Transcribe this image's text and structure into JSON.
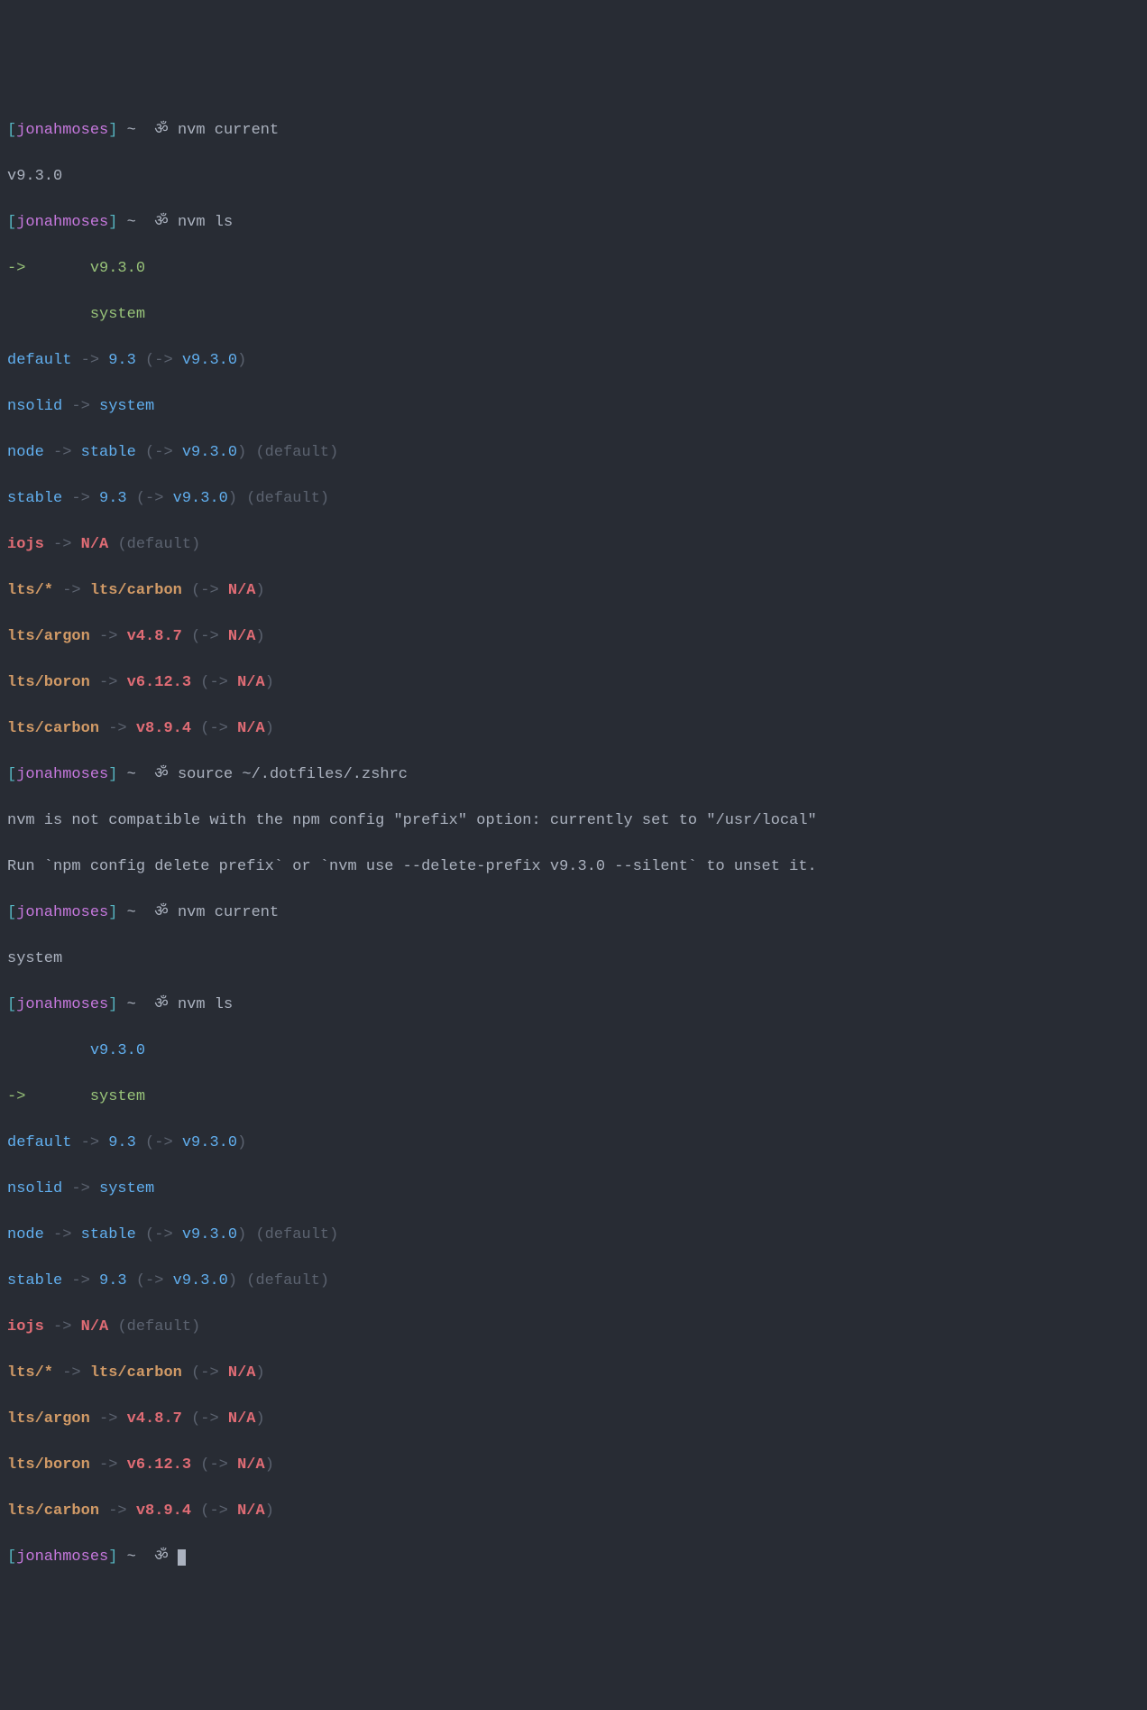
{
  "prompt": {
    "bracket_open": "[",
    "bracket_close": "]",
    "user": "jonahmoses",
    "tilde": "~",
    "om": "ॐ"
  },
  "cmd": {
    "nvm_current": "nvm current",
    "nvm_ls": "nvm ls",
    "source": "source ~/.dotfiles/.zshrc"
  },
  "out": {
    "v930": "v9.3.0",
    "system": "system",
    "arrow_selected": "->",
    "arrow": "->",
    "lp": "(",
    "rp": ")",
    "default_label": "default",
    "nsolid": "nsolid",
    "node": "node",
    "stable": "stable",
    "iojs": "iojs",
    "v93": "9.3",
    "na": "N/A",
    "default_suffix": "(default)",
    "lts_star": "lts/*",
    "lts_carbon_text": "lts/carbon",
    "lts_argon": "lts/argon",
    "lts_boron": "lts/boron",
    "lts_carbon": "lts/carbon",
    "v487": "v4.8.7",
    "v6123": "v6.12.3",
    "v894": "v8.9.4",
    "err1": "nvm is not compatible with the npm config \"prefix\" option: currently set to \"/usr/local\"",
    "err2": "Run `npm config delete prefix` or `nvm use --delete-prefix v9.3.0 --silent` to unset it."
  }
}
